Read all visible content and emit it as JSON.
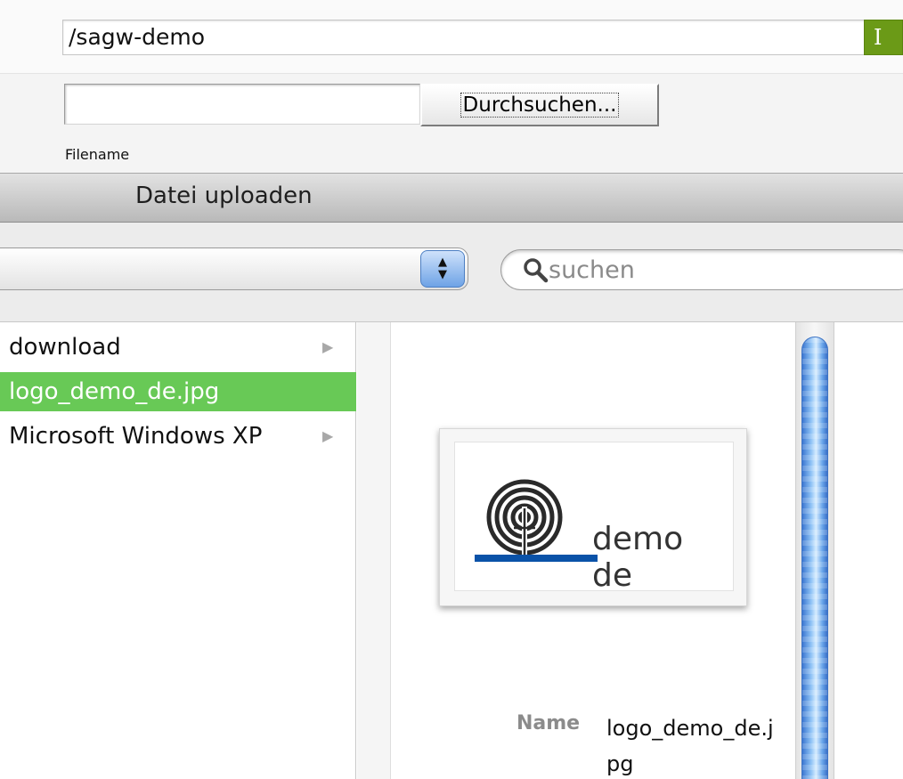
{
  "path_bar": {
    "value": "/sagw-demo",
    "button_label": "I"
  },
  "upload": {
    "file_value": "",
    "browse_label": "Durchsuchen...",
    "filename_label": "Filename",
    "upload_label": "Datei uploaden"
  },
  "toolbar": {
    "search_placeholder": "suchen"
  },
  "browser": {
    "items": [
      {
        "label": "download",
        "has_children": true,
        "selected": false
      },
      {
        "label": "logo_demo_de.jpg",
        "has_children": false,
        "selected": true
      },
      {
        "label": "Microsoft Windows XP",
        "has_children": true,
        "selected": false
      }
    ],
    "arrow_glyph": "▶"
  },
  "preview": {
    "thumbnail_text": "demo de",
    "name_key": "Name",
    "name_value": "logo_demo_de.jpg"
  },
  "colors": {
    "selection": "#68c956",
    "go_button": "#6b9a17",
    "logo_bar": "#0a52a8"
  },
  "icons": {
    "popup": "up-down-arrows-icon",
    "search": "magnifier-icon",
    "disclosure": "triangle-right-icon",
    "logo": "labyrinth-icon"
  }
}
